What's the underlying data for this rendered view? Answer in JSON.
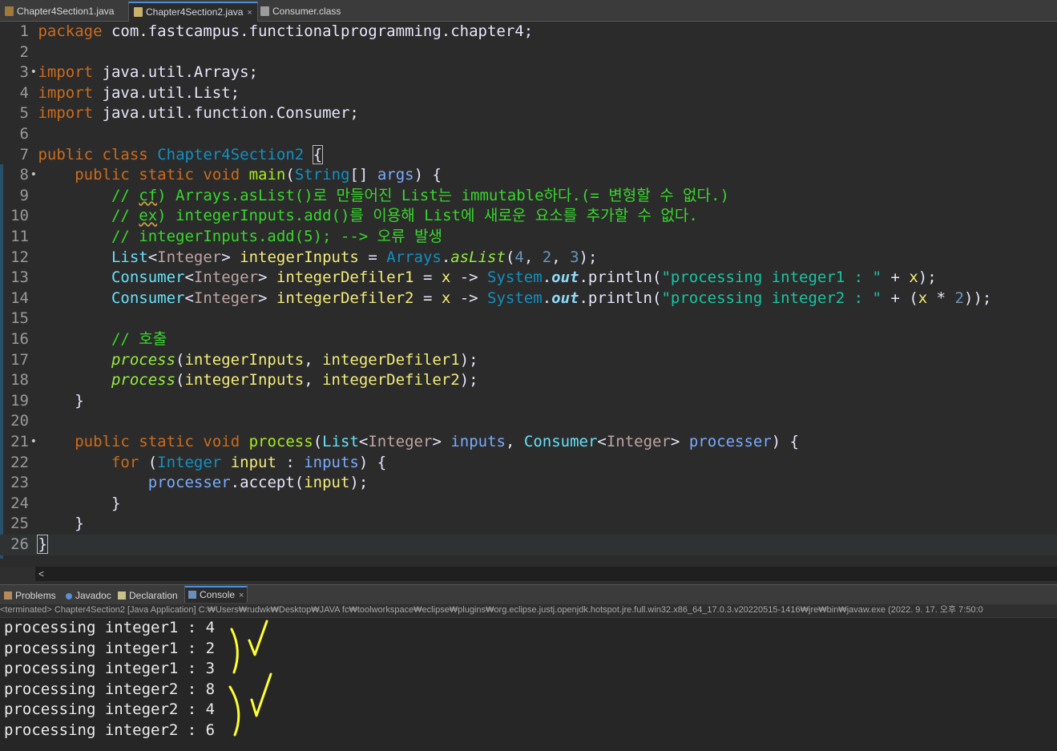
{
  "editor_tabs": [
    {
      "label": "Chapter4Section1.java",
      "active": false
    },
    {
      "label": "Chapter4Section2.java",
      "active": true
    },
    {
      "label": "Consumer.class",
      "active": false
    }
  ],
  "close_glyph": "×",
  "code": {
    "line_numbers": [
      "1",
      "2",
      "3",
      "4",
      "5",
      "6",
      "7",
      "8",
      "9",
      "10",
      "11",
      "12",
      "13",
      "14",
      "15",
      "16",
      "17",
      "18",
      "19",
      "20",
      "21",
      "22",
      "23",
      "24",
      "25",
      "26"
    ],
    "fold_markers": {
      "3": "•",
      "8": "•",
      "21": "•"
    },
    "l1": {
      "kw": "package",
      "rest": " com.fastcampus.functionalprogramming.chapter4;"
    },
    "l3": {
      "kw": "import",
      "rest": " java.util.Arrays;"
    },
    "l4": {
      "kw": "import",
      "rest": " java.util.List;"
    },
    "l5": {
      "kw": "import",
      "rest": " java.util.function.Consumer;"
    },
    "l7": {
      "kw1": "public",
      "kw2": "class",
      "name": "Chapter4Section2",
      "brace": "{"
    },
    "l8": {
      "kw1": "public",
      "kw2": "static",
      "kw3": "void",
      "name": "main",
      "type": "String",
      "arr": "[]",
      "param": "args",
      "tail": ") {"
    },
    "l9": {
      "a": "// ",
      "b": "cf",
      "c": ") Arrays.asList()로 만들어진 List는 immutable하다.(= 변형할 수 없다.)"
    },
    "l10": {
      "a": "// ",
      "b": "ex",
      "c": ") integerInputs.add()를 이용해 List에 새로운 요소를 추가할 수 없다."
    },
    "l11": {
      "a": "// integerInputs.add(5); --> 오류 발생"
    },
    "l12": {
      "t": "List",
      "g": "Integer",
      "v": "integerInputs",
      "eq": " = ",
      "c": "Arrays",
      "m": "asList",
      "n1": "4",
      "n2": "2",
      "n3": "3"
    },
    "l13": {
      "t": "Consumer",
      "g": "Integer",
      "v": "integerDefiler1",
      "x": "x",
      "sys": "System",
      "out": "out",
      "m": "println",
      "s": "\"processing integer1 : \"",
      "x2": "x"
    },
    "l14": {
      "t": "Consumer",
      "g": "Integer",
      "v": "integerDefiler2",
      "x": "x",
      "sys": "System",
      "out": "out",
      "m": "println",
      "s": "\"processing integer2 : \"",
      "x2": "x",
      "n": "2"
    },
    "l16": {
      "c": "// 호출"
    },
    "l17": {
      "m": "process",
      "a1": "integerInputs",
      "a2": "integerDefiler1"
    },
    "l18": {
      "m": "process",
      "a1": "integerInputs",
      "a2": "integerDefiler2"
    },
    "l19": {
      "b": "}"
    },
    "l21": {
      "kw1": "public",
      "kw2": "static",
      "kw3": "void",
      "name": "process",
      "t1": "List",
      "g1": "Integer",
      "p1": "inputs",
      "t2": "Consumer",
      "g2": "Integer",
      "p2": "processer"
    },
    "l22": {
      "kw": "for",
      "t": "Integer",
      "v": "input",
      "col": " : ",
      "p": "inputs"
    },
    "l23": {
      "p": "processer",
      "m": "accept",
      "v": "input"
    },
    "l24": {
      "b": "}"
    },
    "l25": {
      "b": "}"
    },
    "l26": {
      "b": "}"
    }
  },
  "hscroll_glyph": "<",
  "view_tabs": [
    {
      "label": "Problems",
      "active": false
    },
    {
      "label": "Javadoc",
      "active": false
    },
    {
      "label": "Declaration",
      "active": false
    },
    {
      "label": "Console",
      "active": true
    }
  ],
  "terminated_line": "<terminated> Chapter4Section2 [Java Application] C:₩Users₩rudwk₩Desktop₩JAVA fc₩toolworkspace₩eclipse₩plugins₩org.eclipse.justj.openjdk.hotspot.jre.full.win32.x86_64_17.0.3.v20220515-1416₩jre₩bin₩javaw.exe  (2022. 9. 17. 오후 7:50:0",
  "console_output": [
    "processing integer1 : 4",
    "processing integer1 : 2",
    "processing integer1 : 3",
    "processing integer2 : 8",
    "processing integer2 : 4",
    "processing integer2 : 6"
  ],
  "colors": {
    "annotation": "#ffff33",
    "keyword": "#cc6c1d",
    "comment": "#38d82c",
    "string": "#17c6a3"
  }
}
